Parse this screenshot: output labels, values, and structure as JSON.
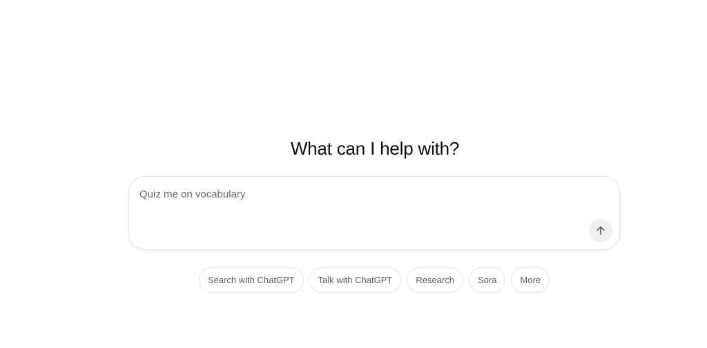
{
  "main": {
    "headline": "What can I help with?"
  },
  "composer": {
    "placeholder": "Quiz me on vocabulary",
    "send_icon": "arrow-up-icon"
  },
  "suggestions": [
    {
      "label": "Search with ChatGPT"
    },
    {
      "label": "Talk with ChatGPT"
    },
    {
      "label": "Research"
    },
    {
      "label": "Sora"
    },
    {
      "label": "More"
    }
  ],
  "colors": {
    "background": "#ffffff",
    "text": "#0d0d0d",
    "placeholder": "#6b6b6b",
    "chip_text": "#5d5d5d",
    "border": "#e3e3e3",
    "send_button_bg": "#f0f0f0"
  }
}
